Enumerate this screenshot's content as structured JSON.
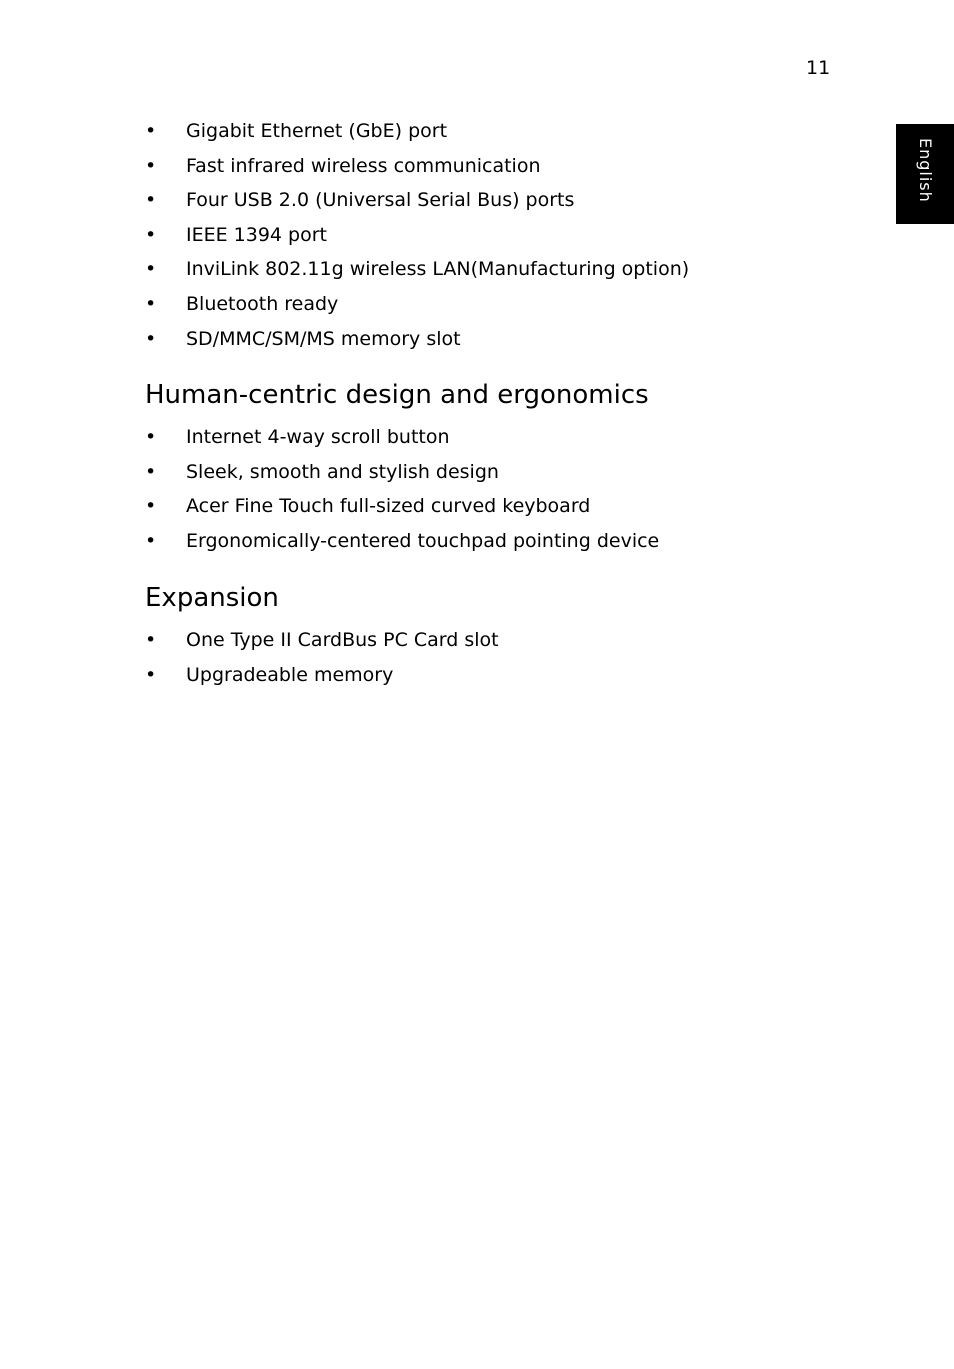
{
  "page_number": "11",
  "language_tab": "English",
  "bullet_char": "•",
  "connectivity": {
    "items": [
      "Gigabit Ethernet (GbE) port",
      "Fast infrared wireless communication",
      "Four USB 2.0 (Universal Serial Bus) ports",
      "IEEE 1394 port",
      "InviLink 802.11g wireless LAN(Manufacturing option)",
      "Bluetooth ready",
      "SD/MMC/SM/MS memory slot"
    ]
  },
  "human_centric": {
    "heading": "Human-centric design and ergonomics",
    "items": [
      "Internet 4-way scroll button",
      "Sleek, smooth and stylish design",
      "Acer Fine Touch full-sized curved keyboard",
      "Ergonomically-centered touchpad pointing device"
    ]
  },
  "expansion": {
    "heading": "Expansion",
    "items": [
      "One Type II CardBus PC Card slot",
      "Upgradeable memory"
    ]
  }
}
